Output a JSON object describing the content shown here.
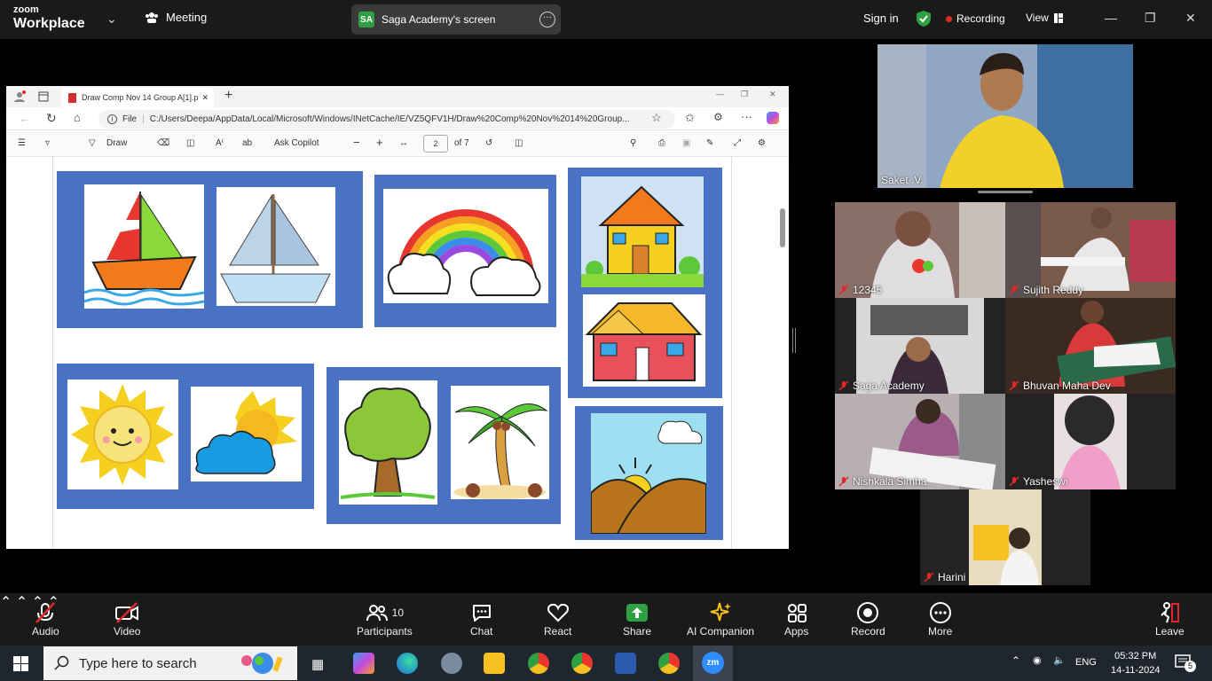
{
  "zoom_top": {
    "brand_line1": "zoom",
    "brand_line2": "Workplace",
    "meeting_label": "Meeting",
    "share_badge": "SA",
    "share_label": "Saga Academy's screen",
    "sign_in": "Sign in",
    "recording": "Recording",
    "view": "View"
  },
  "browser": {
    "tab_title": "Draw Comp Nov 14 Group A[1].p",
    "file_label": "File",
    "address": "C:/Users/Deepa/AppData/Local/Microsoft/Windows/INetCache/IE/VZ5QFV1H/Draw%20Comp%20Nov%2014%20Group...",
    "draw_label": "Draw",
    "ask_copilot": "Ask Copilot",
    "page_current": "2",
    "page_total": "of 7"
  },
  "participants_video": {
    "speaker": "Saket .V.",
    "tiles": [
      {
        "name": "12345"
      },
      {
        "name": "Sujith Reddy"
      },
      {
        "name": "Saga Academy"
      },
      {
        "name": "Bhuvan Maha Dev"
      },
      {
        "name": "Nishkala Simha"
      },
      {
        "name": "Yasheswi"
      },
      {
        "name": "Harini"
      }
    ]
  },
  "controls": {
    "audio": "Audio",
    "video": "Video",
    "participants": "Participants",
    "participants_count": "10",
    "chat": "Chat",
    "react": "React",
    "share": "Share",
    "ai": "AI Companion",
    "apps": "Apps",
    "record": "Record",
    "more": "More",
    "leave": "Leave"
  },
  "taskbar": {
    "search_placeholder": "Type here to search",
    "lang": "ENG",
    "time": "05:32 PM",
    "date": "14-11-2024",
    "notif_count": "5"
  },
  "colors": {
    "zoom_bar": "#1a1a1a",
    "card_blue": "#4a72c4",
    "share_green": "#2ea043",
    "rec_red": "#e02828",
    "mic_off_red": "#e02828"
  }
}
